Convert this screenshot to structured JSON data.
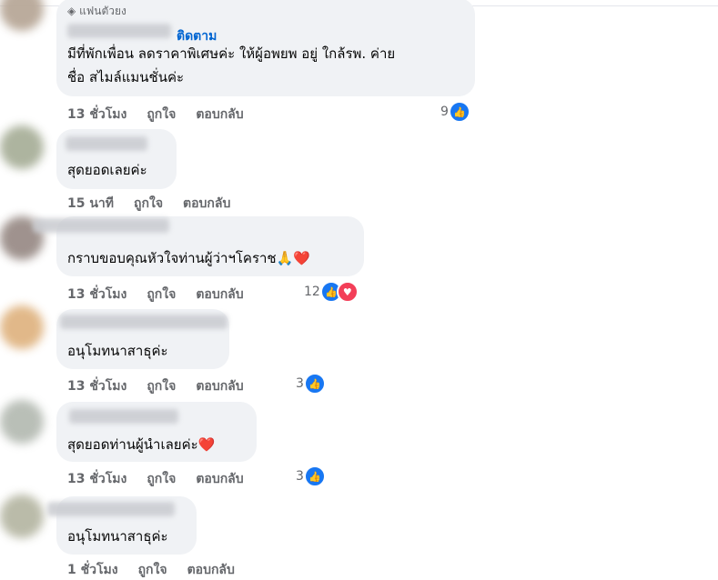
{
  "colors": {
    "bubble": "#f0f2f5",
    "link": "#0064d1",
    "meta": "#65676b",
    "like": "#1877f2",
    "love": "#f33e58"
  },
  "comments": [
    {
      "badge": "แฟนตัวยง",
      "follow_label": "ติดตาม",
      "lines": [
        "มีที่พักเพื่อน ลดราคาพิเศษค่ะ ให้ผู้อพยพ อยู่ ใกล้รพ. ค่าย",
        "ชื่อ สไมล์แมนชั่นค่ะ"
      ],
      "time": "13 ชั่วโมง",
      "like": "ถูกใจ",
      "reply": "ตอบกลับ",
      "reaction_count": "9",
      "reactions": [
        "like-icon"
      ]
    },
    {
      "text": "สุดยอดเลยค่ะ",
      "time": "15 นาที",
      "like": "ถูกใจ",
      "reply": "ตอบกลับ"
    },
    {
      "text": "กราบขอบคุณหัวใจท่านผู้ว่าฯโคราช",
      "emojis": "🙏❤️",
      "time": "13 ชั่วโมง",
      "like": "ถูกใจ",
      "reply": "ตอบกลับ",
      "reaction_count": "12",
      "reactions": [
        "like-icon",
        "love-icon"
      ]
    },
    {
      "text": "อนุโมทนาสาธุค่ะ",
      "time": "13 ชั่วโมง",
      "like": "ถูกใจ",
      "reply": "ตอบกลับ",
      "reaction_count": "3",
      "reactions": [
        "like-icon"
      ]
    },
    {
      "text": "สุดยอดท่านผู้นำเลยค่ะ",
      "emojis": "❤️",
      "time": "13 ชั่วโมง",
      "like": "ถูกใจ",
      "reply": "ตอบกลับ",
      "reaction_count": "3",
      "reactions": [
        "like-icon"
      ]
    },
    {
      "text": "อนุโมทนาสาธุค่ะ",
      "time": "1 ชั่วโมง",
      "like": "ถูกใจ",
      "reply": "ตอบกลับ"
    }
  ]
}
